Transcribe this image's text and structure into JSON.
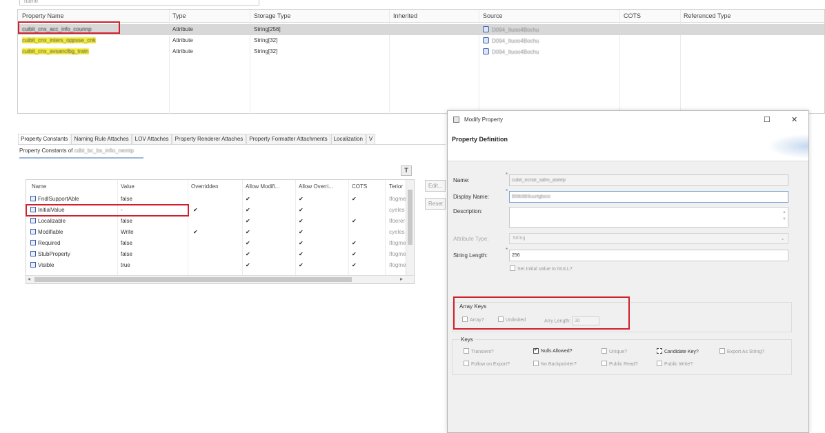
{
  "top_filter": {
    "value": "name"
  },
  "property_table": {
    "columns": [
      "Property Name",
      "Type",
      "Storage Type",
      "Inherited",
      "Source",
      "COTS",
      "Referenced Type"
    ],
    "rows": [
      {
        "name": "cuibit_cnx_acc_info_counnp",
        "type": "Attribute",
        "storage": "String[256]",
        "source": "D094_Ituoo4Bochu"
      },
      {
        "name": "cuibit_cnx_inters_oppsse_cnk",
        "type": "Attribute",
        "storage": "String[32]",
        "source": "D094_Ituoo4Bochu"
      },
      {
        "name": "cuibit_cnx_avsanclbg_tratn",
        "type": "Attribute",
        "storage": "String[32]",
        "source": "D094_Ituoo4Bochu"
      }
    ]
  },
  "tabs": [
    "Property Constants",
    "Naming Rule Attaches",
    "LOV Attaches",
    "Property Renderer Attaches",
    "Property Formatter Attachments",
    "Localization",
    "V"
  ],
  "constants_title": {
    "label": "Property Constants of",
    "value": "cdbl_bc_bs_infio_nemtp"
  },
  "filter_button": "T",
  "constants_table": {
    "columns": [
      "Name",
      "Value",
      "Overridden",
      "Allow Modifi...",
      "Allow Overri...",
      "COTS",
      "Terior"
    ],
    "rows": [
      {
        "name": "FndlSupportAble",
        "value": "false",
        "overridden": "",
        "allow_modify": "✔",
        "allow_override": "✔",
        "cots": "✔",
        "extra": "Ifogme"
      },
      {
        "name": "InitialValue",
        "value": "-",
        "overridden": "✔",
        "allow_modify": "✔",
        "allow_override": "✔",
        "cots": "",
        "extra": "cyeles"
      },
      {
        "name": "Localizable",
        "value": "false",
        "overridden": "",
        "allow_modify": "✔",
        "allow_override": "✔",
        "cots": "✔",
        "extra": "Ifoerer"
      },
      {
        "name": "Modifiable",
        "value": "Write",
        "overridden": "✔",
        "allow_modify": "✔",
        "allow_override": "✔",
        "cots": "",
        "extra": "cyeles"
      },
      {
        "name": "Required",
        "value": "false",
        "overridden": "",
        "allow_modify": "✔",
        "allow_override": "✔",
        "cots": "✔",
        "extra": "Ifogme"
      },
      {
        "name": "StubProperty",
        "value": "false",
        "overridden": "",
        "allow_modify": "✔",
        "allow_override": "✔",
        "cots": "✔",
        "extra": "Ifogme"
      },
      {
        "name": "Visible",
        "value": "true",
        "overridden": "",
        "allow_modify": "✔",
        "allow_override": "✔",
        "cots": "✔",
        "extra": "Ifogme"
      }
    ]
  },
  "side_buttons": [
    "Edit...",
    "Reset"
  ],
  "dialog": {
    "window_title": "Modify Property",
    "header_title": "Property Definition",
    "name_label": "Name:",
    "name_value": "cubit_ecrse_sahn_aseep",
    "display_name_label": "Display Name:",
    "display_name_value": "Bl9b9B9uurtgbicic",
    "description_label": "Description:",
    "attribute_type_label": "Attribute Type:",
    "attribute_type_value": "String",
    "string_length_label": "String Length:",
    "string_length_value": "256",
    "null_checkbox_label": "Set Initial Value to NULL?",
    "array_group": {
      "title": "Array Keys",
      "array_label": "Array?",
      "unlimited_label": "Unlimited",
      "max_length_label": "Arry Length:",
      "max_length_value": "30"
    },
    "keys_group": {
      "title": "Keys",
      "transient": "Transient?",
      "nulls_allowed": "Nulls Allowed?",
      "unique": "Unique?",
      "candidate_key": "Candidate Key?",
      "export_as_string": "Export As String?",
      "follow_on_export": "Follow on Export?",
      "no_backpointer": "No Backpointer?",
      "public_read": "Public Read?",
      "public_write": "Public Write?"
    }
  }
}
